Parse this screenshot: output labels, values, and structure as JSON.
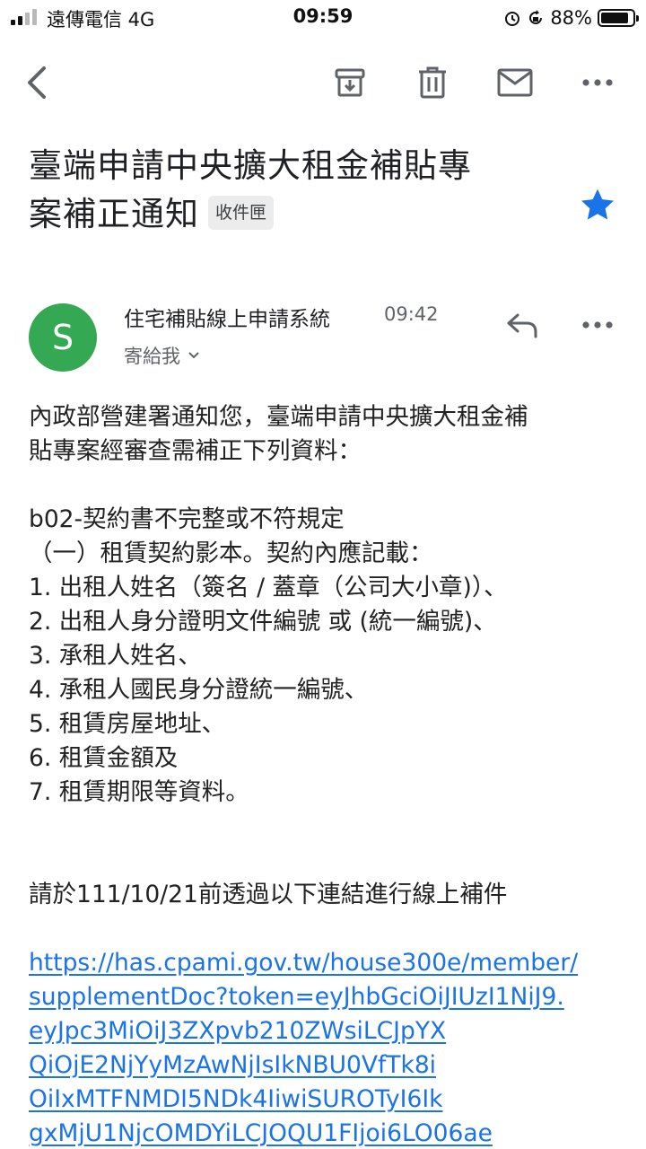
{
  "status_bar": {
    "carrier": "遠傳電信  4G",
    "time": "09:59",
    "battery_percent": "88%",
    "battery_level": 0.88
  },
  "toolbar": {
    "back_icon": "back-arrow-icon",
    "archive_icon": "archive-icon",
    "delete_icon": "trash-icon",
    "mark_unread_icon": "mail-icon",
    "more_icon": "more-horizontal-icon"
  },
  "email": {
    "subject_line1": "臺端申請中央擴大租金補貼專",
    "subject_line2": "案補正通知",
    "label": "收件匣",
    "starred": true,
    "star_color": "#1a73e8",
    "sender_initial": "S",
    "avatar_color": "#34a853",
    "sender_name": "住宅補貼線上申請系統",
    "sent_time": "09:42",
    "recipient": "寄給我",
    "body": {
      "intro_line1": "內政部營建署通知您，臺端申請中央擴大租金補",
      "intro_line2": "貼專案經審查需補正下列資料：",
      "item_code": "b02-契約書不完整或不符規定",
      "item_subtitle": "（一）租賃契約影本。契約內應記載：",
      "list": [
        "1. 出租人姓名（簽名 / 蓋章（公司大小章)）、",
        "2. 出租人身分證明文件編號 或 (統一編號)、",
        "3. 承租人姓名、",
        "4. 承租人國民身分證統一編號、",
        "5. 租賃房屋地址、",
        "6. 租賃金額及",
        "7. 租賃期限等資料。"
      ],
      "deadline": "請於111/10/21前透過以下連結進行線上補件",
      "link_lines": [
        "https://has.cpami.gov.tw/house300e/member/",
        "supplementDoc?token=eyJhbGciOiJIUzI1NiJ9.",
        "eyJpc3MiOiJ3ZXpvb210ZWsiLCJpYX",
        "QiOjE2NjYyMzAwNjIsIkNBU0VfTk8i",
        "OiIxMTFNMDI5NDk4IiwiSUROTyI6Ik",
        "gxMjU1NjcOMDYiLCJOQU1FIjoi6LO06ae"
      ],
      "link_color": "#1a73e8"
    }
  }
}
